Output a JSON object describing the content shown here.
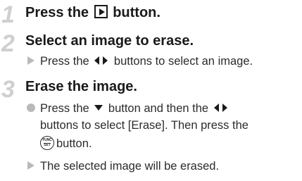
{
  "steps": [
    {
      "number": "1",
      "title_prefix": "Press the",
      "title_suffix": "button."
    },
    {
      "number": "2",
      "title": "Select an image to erase.",
      "instruction_prefix": "Press the",
      "instruction_suffix": "buttons to select an image."
    },
    {
      "number": "3",
      "title": "Erase the image.",
      "bullet_line1_prefix": "Press the",
      "bullet_line1_middle": "button and then the",
      "bullet_line2": "buttons to select [Erase]. Then press the",
      "bullet_line3_suffix": "button.",
      "result": "The selected image will be erased."
    }
  ],
  "icons": {
    "func_set_top": "FUNC",
    "func_set_bottom": "SET"
  },
  "colors": {
    "step_number": "#cfcfcf",
    "marker": "#b9b9b9",
    "text": "#1a1a1a"
  }
}
